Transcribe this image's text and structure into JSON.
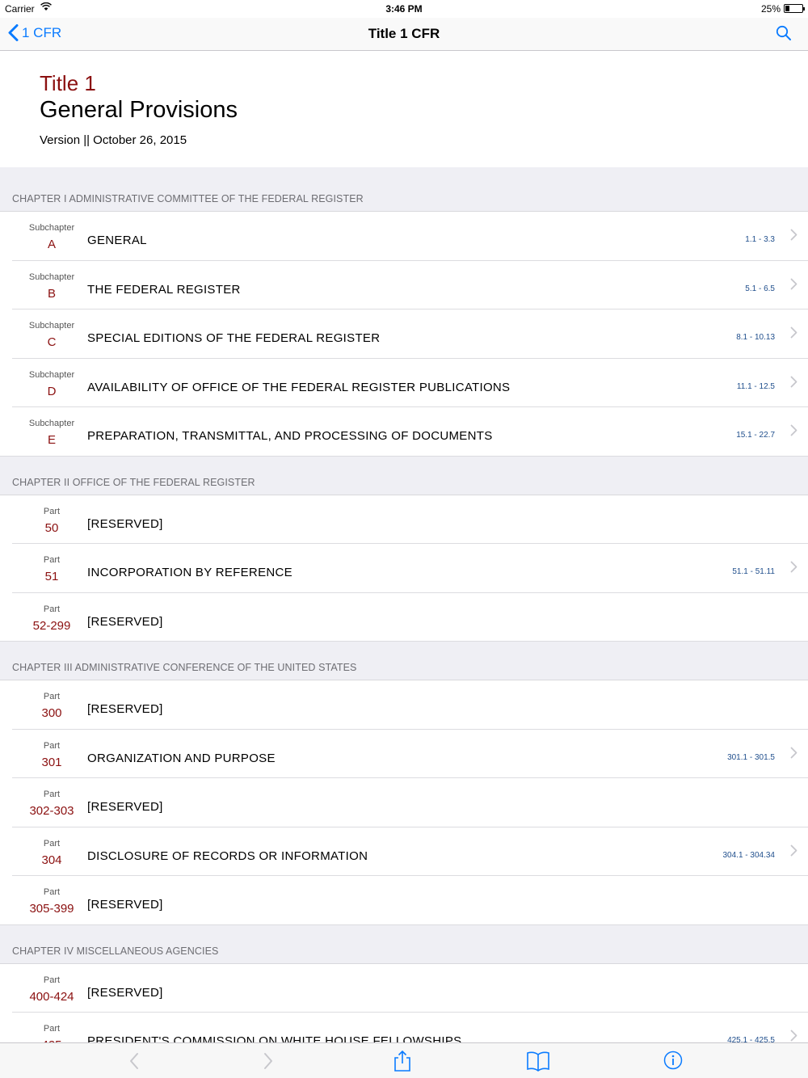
{
  "status": {
    "carrier": "Carrier",
    "time": "3:46 PM",
    "battery": "25%",
    "battery_level": 0.25
  },
  "nav": {
    "back_label": "1 CFR",
    "title": "Title 1 CFR"
  },
  "header": {
    "title_num": "Title 1",
    "title_name": "General Provisions",
    "version": "Version || October 26, 2015"
  },
  "chapters": [
    {
      "title": "CHAPTER I ADMINISTRATIVE COMMITTEE OF THE FEDERAL REGISTER",
      "rows": [
        {
          "kind": "Subchapter",
          "num": "A",
          "label": "GENERAL",
          "range": "1.1 - 3.3",
          "chevron": true
        },
        {
          "kind": "Subchapter",
          "num": "B",
          "label": "THE FEDERAL REGISTER",
          "range": "5.1 - 6.5",
          "chevron": true
        },
        {
          "kind": "Subchapter",
          "num": "C",
          "label": "SPECIAL EDITIONS OF THE FEDERAL REGISTER",
          "range": "8.1 - 10.13",
          "chevron": true
        },
        {
          "kind": "Subchapter",
          "num": "D",
          "label": "AVAILABILITY OF OFFICE OF THE FEDERAL REGISTER PUBLICATIONS",
          "range": "11.1 - 12.5",
          "chevron": true
        },
        {
          "kind": "Subchapter",
          "num": "E",
          "label": "PREPARATION, TRANSMITTAL, AND PROCESSING OF DOCUMENTS",
          "range": "15.1 - 22.7",
          "chevron": true
        }
      ]
    },
    {
      "title": "CHAPTER II OFFICE OF THE FEDERAL REGISTER",
      "rows": [
        {
          "kind": "Part",
          "num": "50",
          "label": "[RESERVED]",
          "range": "",
          "chevron": false
        },
        {
          "kind": "Part",
          "num": "51",
          "label": "INCORPORATION BY REFERENCE",
          "range": "51.1 - 51.11",
          "chevron": true
        },
        {
          "kind": "Part",
          "num": "52-299",
          "label": "[RESERVED]",
          "range": "",
          "chevron": false
        }
      ]
    },
    {
      "title": "CHAPTER III ADMINISTRATIVE CONFERENCE OF THE UNITED STATES",
      "rows": [
        {
          "kind": "Part",
          "num": "300",
          "label": "[RESERVED]",
          "range": "",
          "chevron": false
        },
        {
          "kind": "Part",
          "num": "301",
          "label": "ORGANIZATION AND PURPOSE",
          "range": "301.1 - 301.5",
          "chevron": true
        },
        {
          "kind": "Part",
          "num": "302-303",
          "label": "[RESERVED]",
          "range": "",
          "chevron": false
        },
        {
          "kind": "Part",
          "num": "304",
          "label": "DISCLOSURE OF RECORDS OR INFORMATION",
          "range": "304.1 - 304.34",
          "chevron": true
        },
        {
          "kind": "Part",
          "num": "305-399",
          "label": "[RESERVED]",
          "range": "",
          "chevron": false
        }
      ]
    },
    {
      "title": "CHAPTER IV MISCELLANEOUS AGENCIES",
      "rows": [
        {
          "kind": "Part",
          "num": "400-424",
          "label": "[RESERVED]",
          "range": "",
          "chevron": false
        },
        {
          "kind": "Part",
          "num": "425",
          "label": "PRESIDENT'S COMMISSION ON WHITE HOUSE FELLOWSHIPS",
          "range": "425.1 - 425.5",
          "chevron": true
        }
      ]
    }
  ],
  "toolbar": {
    "items": [
      "back-arrow-icon",
      "forward-arrow-icon",
      "share-icon",
      "book-icon",
      "info-icon"
    ]
  }
}
